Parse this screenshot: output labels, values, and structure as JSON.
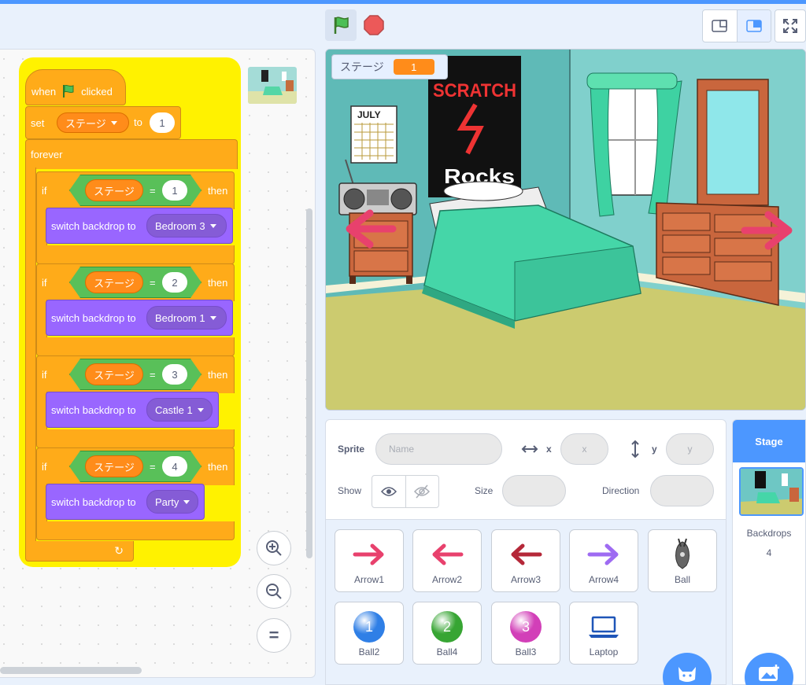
{
  "toolbar": {
    "green_flag": "green-flag-icon",
    "stop": "stop-icon",
    "small_stage": "small-stage-icon",
    "normal_stage": "normal-stage-icon",
    "fullscreen": "fullscreen-icon"
  },
  "script": {
    "hat": {
      "when": "when",
      "clicked": "clicked"
    },
    "set_block": {
      "set": "set",
      "variable": "ステージ",
      "to": "to",
      "value": "1"
    },
    "forever": "forever",
    "if_blocks": [
      {
        "if": "if",
        "variable": "ステージ",
        "eq": "=",
        "value": "1",
        "then": "then",
        "action": "switch backdrop to",
        "backdrop": "Bedroom 3"
      },
      {
        "if": "if",
        "variable": "ステージ",
        "eq": "=",
        "value": "2",
        "then": "then",
        "action": "switch backdrop to",
        "backdrop": "Bedroom 1"
      },
      {
        "if": "if",
        "variable": "ステージ",
        "eq": "=",
        "value": "3",
        "then": "then",
        "action": "switch backdrop to",
        "backdrop": "Castle 1"
      },
      {
        "if": "if",
        "variable": "ステージ",
        "eq": "=",
        "value": "4",
        "then": "then",
        "action": "switch backdrop to",
        "backdrop": "Party"
      }
    ],
    "loop_arrow": "↻"
  },
  "zoom": {
    "in": "zoom-in-icon",
    "out": "zoom-out-icon",
    "reset": "="
  },
  "stage_monitor": {
    "name": "ステージ",
    "value": "1"
  },
  "poster": {
    "line1": "SCRATCH",
    "line2": "Rocks"
  },
  "calendar": {
    "month": "JULY"
  },
  "sprite_info": {
    "sprite_label": "Sprite",
    "name_placeholder": "Name",
    "x_label": "x",
    "x_placeholder": "x",
    "y_label": "y",
    "y_placeholder": "y",
    "show_label": "Show",
    "size_label": "Size",
    "direction_label": "Direction"
  },
  "sprites": [
    {
      "name": "Arrow1",
      "icon": "arrow-right-icon",
      "color": "#e8416d"
    },
    {
      "name": "Arrow2",
      "icon": "arrow-left-icon",
      "color": "#e8416d"
    },
    {
      "name": "Arrow3",
      "icon": "arrow-left-icon",
      "color": "#b52839"
    },
    {
      "name": "Arrow4",
      "icon": "arrow-right-icon",
      "color": "#9e6bf2"
    },
    {
      "name": "Ball",
      "icon": "ball-sprite-icon",
      "color": "#555555"
    },
    {
      "name": "Ball2",
      "icon": "ball-icon",
      "number": "1",
      "color": "#2f7fe6"
    },
    {
      "name": "Ball4",
      "icon": "ball-icon",
      "number": "2",
      "color": "#37a533"
    },
    {
      "name": "Ball3",
      "icon": "ball-icon",
      "number": "3",
      "color": "#d23fb8"
    },
    {
      "name": "Laptop",
      "icon": "laptop-icon",
      "color": "#1e55b8"
    }
  ],
  "stage_panel": {
    "tab": "Stage",
    "backdrops_label": "Backdrops",
    "backdrops_count": "4"
  }
}
